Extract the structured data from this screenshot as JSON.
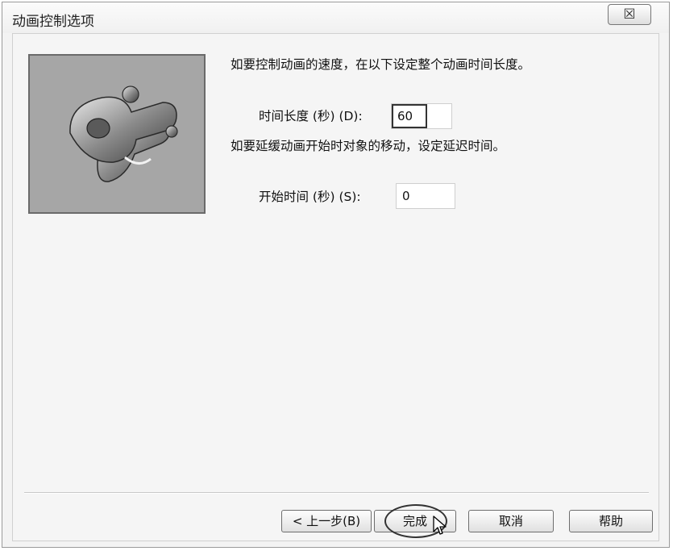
{
  "window": {
    "title": "动画控制选项",
    "close_glyph": "☒"
  },
  "intro_text": "如要控制动画的速度，在以下设定整个动画时间长度。",
  "duration": {
    "label": "时间长度 (秒) (D):",
    "value": "60"
  },
  "delay_text": "如要延缓动画开始时对象的移动，设定延迟时间。",
  "start": {
    "label": "开始时间 (秒) (S):",
    "value": "0"
  },
  "buttons": {
    "back": "< 上一步(B)",
    "finish": "完成",
    "cancel": "取消",
    "help": "帮助"
  },
  "colors": {
    "preview_bg": "#a6a6a6",
    "dialog_bg": "#f5f5f5"
  },
  "icons": {
    "preview": "mechanical-part-preview-icon",
    "cursor": "mouse-cursor-icon"
  }
}
